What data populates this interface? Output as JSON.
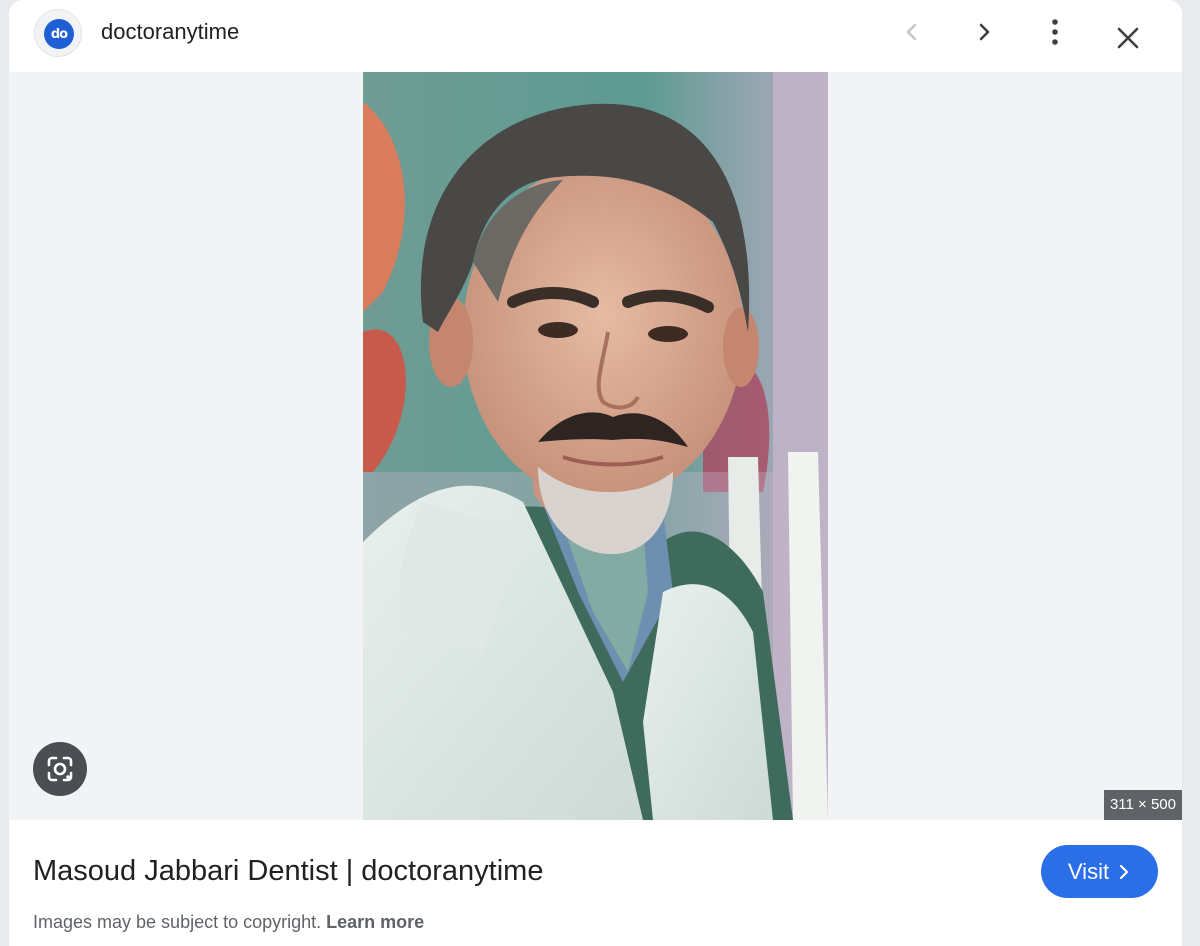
{
  "header": {
    "source_name": "doctoranytime",
    "favicon_text": "do",
    "favicon_color": "#1f5fd6",
    "icons": [
      "chevron-left-icon",
      "chevron-right-icon",
      "more-vert-icon",
      "close-icon"
    ]
  },
  "viewer": {
    "image_dimensions": "311 × 500",
    "lens_icon": "google-lens-icon"
  },
  "footer": {
    "title": "Masoud Jabbari Dentist | doctoranytime",
    "visit_label": "Visit",
    "copyright_text": "Images may be subject to copyright.",
    "learn_more_label": "Learn more",
    "accent_color": "#2a6ee8"
  }
}
